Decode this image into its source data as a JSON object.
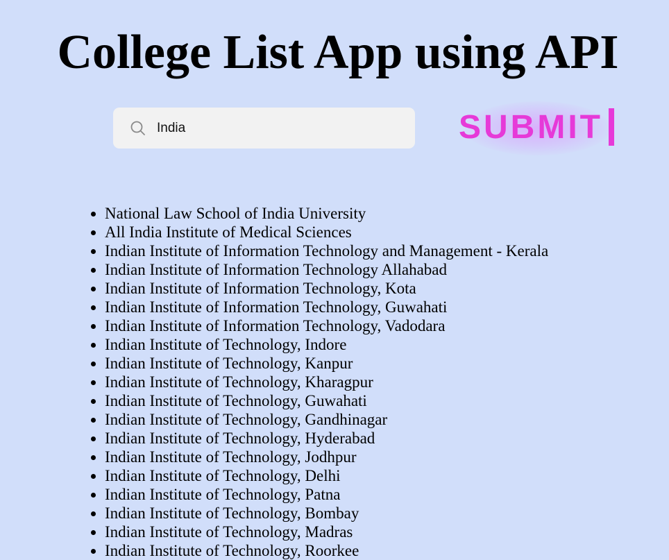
{
  "page": {
    "title": "College List App using API"
  },
  "search": {
    "value": "India",
    "icon": "search-icon"
  },
  "submit": {
    "label": "SUBMIT",
    "color": "#e63ad8"
  },
  "colors": {
    "background": "#d1defa",
    "input_background": "#f2f2f2"
  },
  "colleges": [
    "National Law School of India University",
    "All India Institute of Medical Sciences",
    "Indian Institute of Information Technology and Management - Kerala",
    "Indian Institute of Information Technology Allahabad",
    "Indian Institute of Information Technology, Kota",
    "Indian Institute of Information Technology, Guwahati",
    "Indian Institute of Information Technology, Vadodara",
    "Indian Institute of Technology, Indore",
    "Indian Institute of Technology, Kanpur",
    "Indian Institute of Technology, Kharagpur",
    "Indian Institute of Technology, Guwahati",
    "Indian Institute of Technology, Gandhinagar",
    "Indian Institute of Technology, Hyderabad",
    "Indian Institute of Technology, Jodhpur",
    "Indian Institute of Technology, Delhi",
    "Indian Institute of Technology, Patna",
    "Indian Institute of Technology, Bombay",
    "Indian Institute of Technology, Madras",
    "Indian Institute of Technology, Roorkee"
  ]
}
